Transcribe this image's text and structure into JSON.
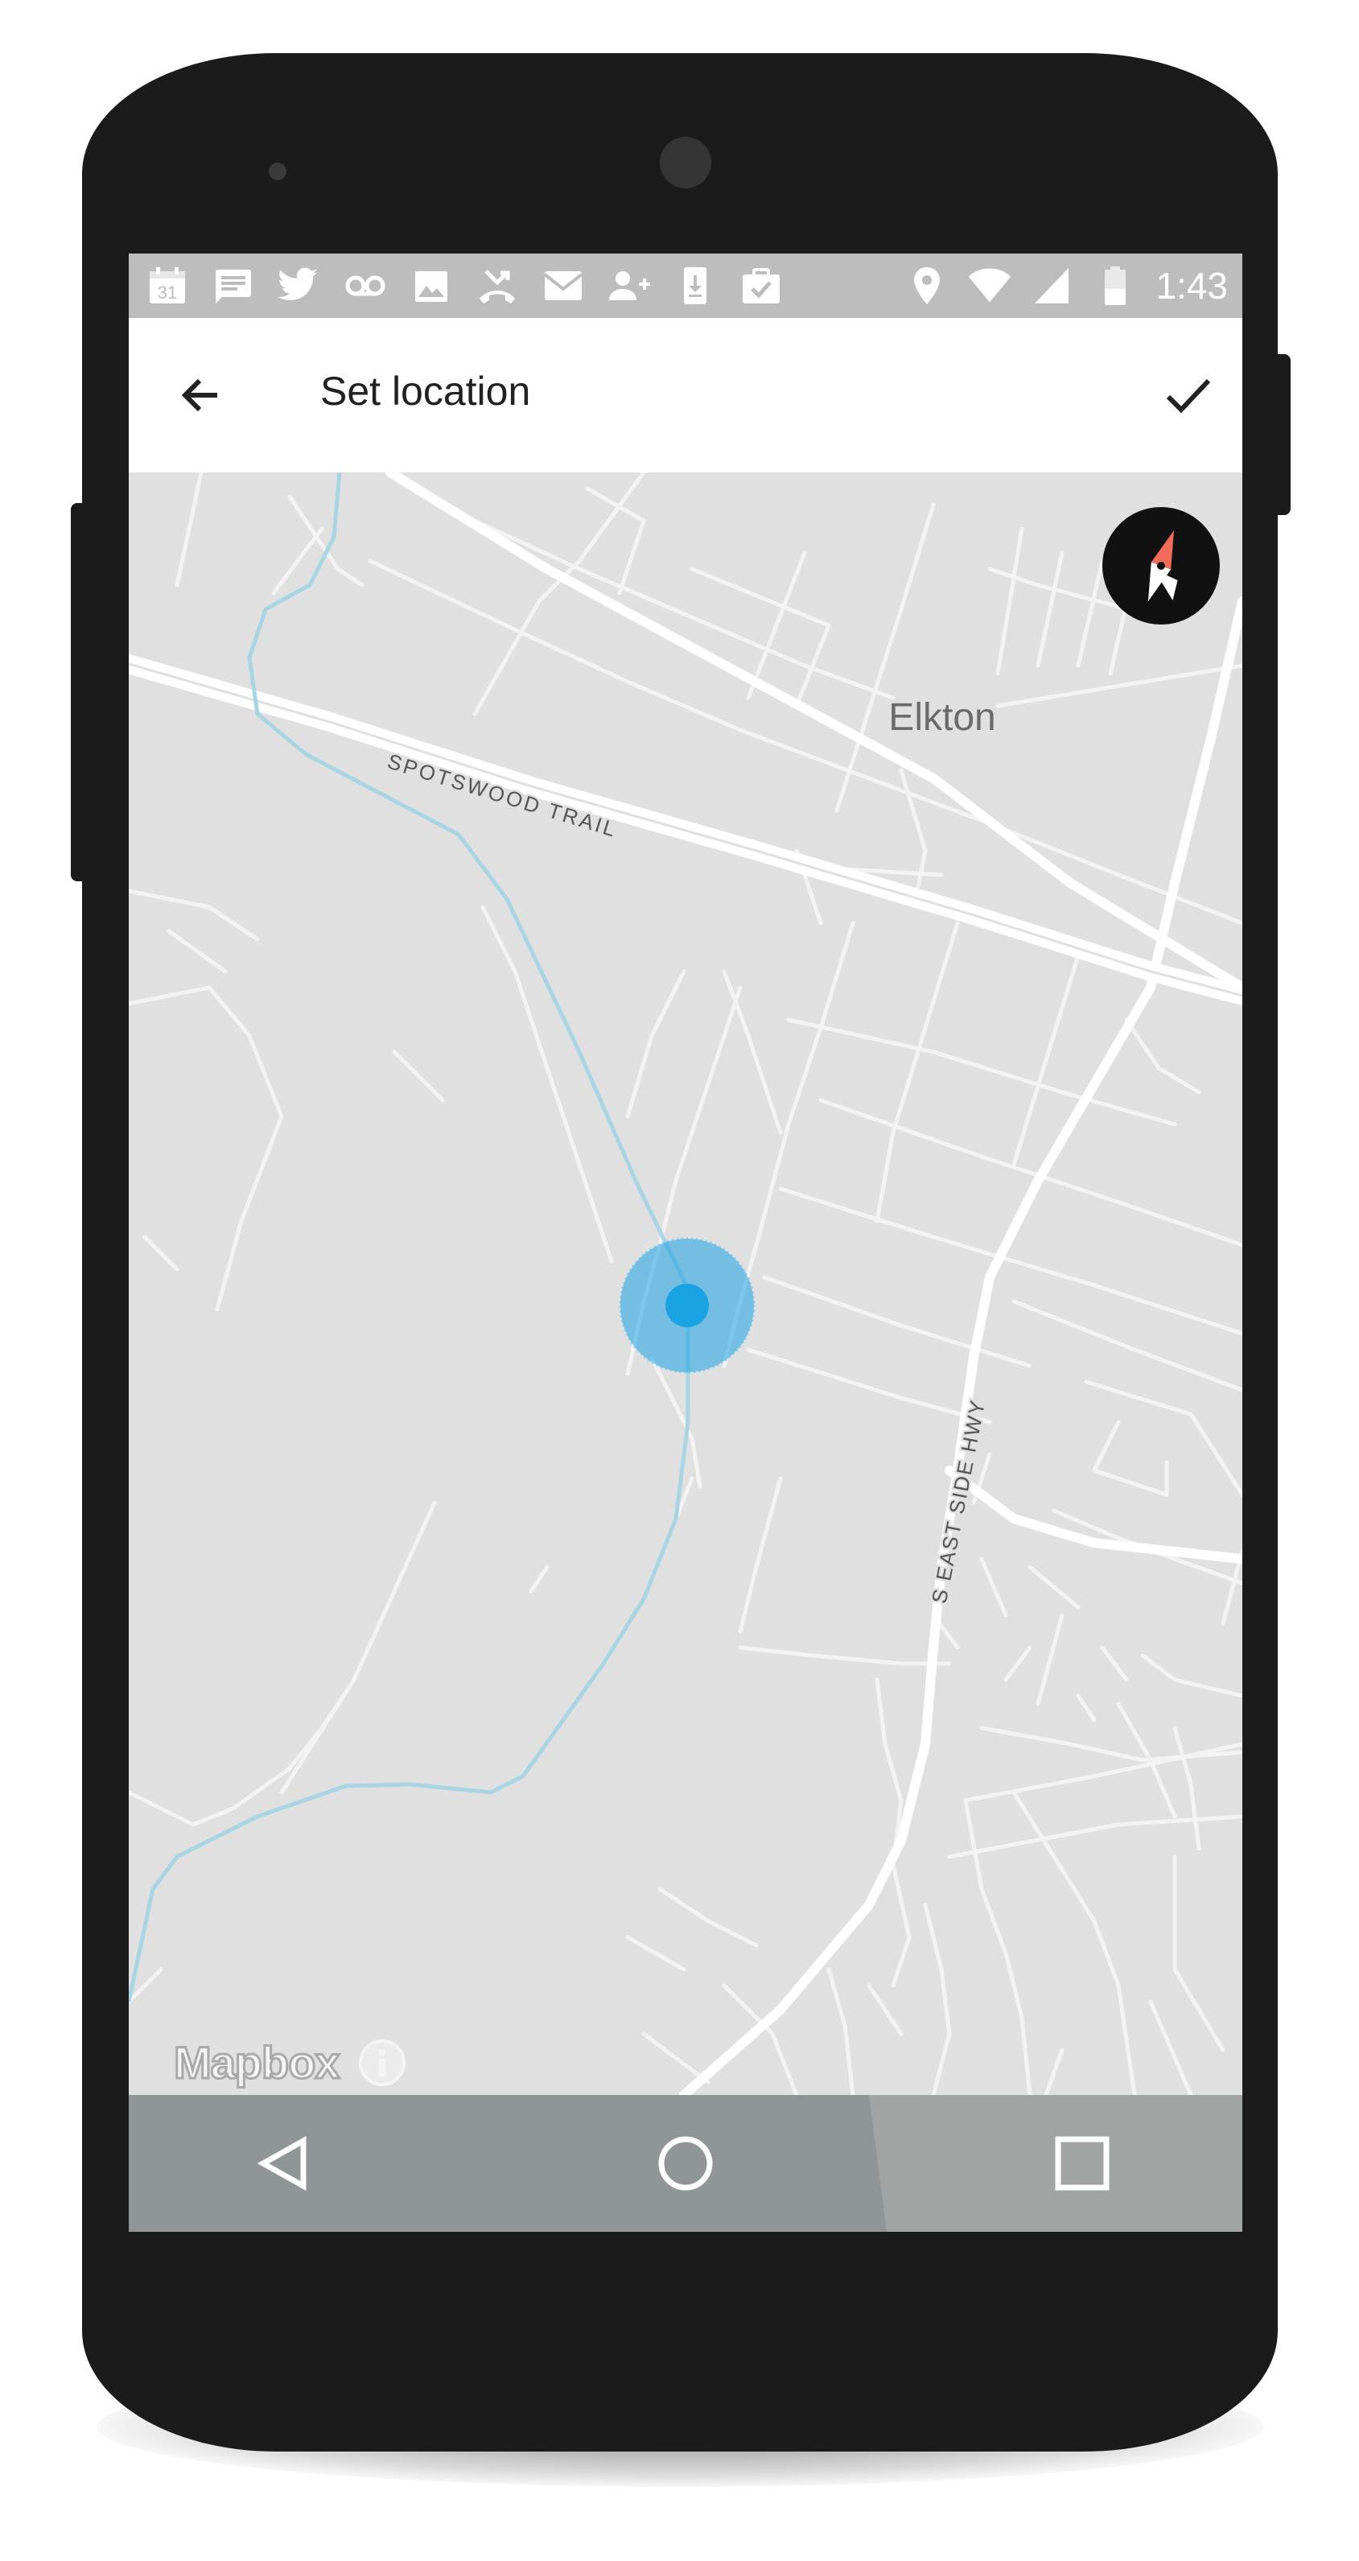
{
  "app": {
    "title": "Set location"
  },
  "status_bar": {
    "time": "1:43",
    "calendar_day": "31",
    "notification_icons": [
      "calendar-icon",
      "message-icon",
      "twitter-icon",
      "voicemail-icon",
      "image-icon",
      "missed-call-icon",
      "email-icon",
      "add-contact-icon",
      "download-icon",
      "clipboard-check-icon"
    ],
    "system_icons": [
      "location-icon",
      "wifi-icon",
      "cellular-signal-icon",
      "battery-icon"
    ]
  },
  "toolbar": {
    "back_icon": "arrow-left-icon",
    "confirm_icon": "check-icon"
  },
  "map": {
    "labels": {
      "town": "Elkton",
      "road_1": "SPOTSWOOD TRAIL",
      "road_2": "S EAST SIDE HWY"
    },
    "attribution": "Mapbox",
    "colors": {
      "land": "#e0e0e0",
      "roads": "#ffffff",
      "water": "#a9d4e4",
      "location_marker": "#1aa3e3",
      "compass_north": "#f16b5b"
    }
  },
  "navigation_bar": {
    "buttons": [
      "back-icon",
      "home-icon",
      "recents-icon"
    ]
  }
}
